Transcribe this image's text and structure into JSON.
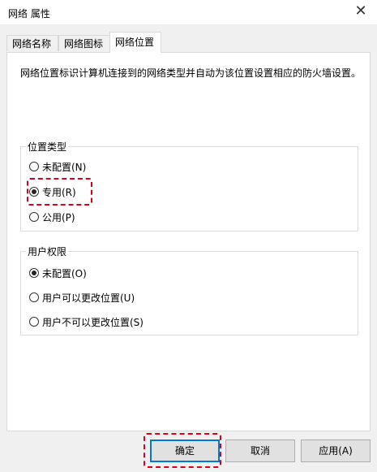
{
  "window": {
    "title": "网络 属性"
  },
  "tabs": [
    {
      "label": "网络名称"
    },
    {
      "label": "网络图标"
    },
    {
      "label": "网络位置"
    }
  ],
  "description": "网络位置标识计算机连接到的网络类型并自动为该位置设置相应的防火墙设置。",
  "location_type": {
    "title": "位置类型",
    "options": [
      {
        "label": "未配置(N)",
        "selected": false
      },
      {
        "label": "专用(R)",
        "selected": true
      },
      {
        "label": "公用(P)",
        "selected": false
      }
    ]
  },
  "user_permissions": {
    "title": "用户权限",
    "options": [
      {
        "label": "未配置(O)",
        "selected": true
      },
      {
        "label": "用户可以更改位置(U)",
        "selected": false
      },
      {
        "label": "用户不可以更改位置(S)",
        "selected": false
      }
    ]
  },
  "buttons": {
    "ok": "确定",
    "cancel": "取消",
    "apply": "应用(A)"
  },
  "colors": {
    "highlight": "#d9001b",
    "accent": "#0078d7"
  }
}
